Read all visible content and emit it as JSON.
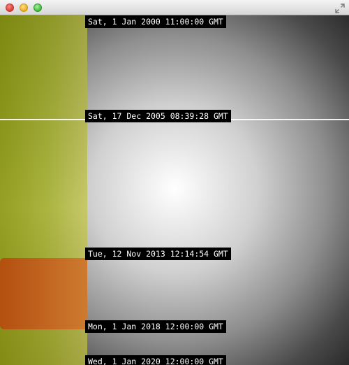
{
  "window": {
    "buttons": [
      "close",
      "minimize",
      "zoom"
    ],
    "fullscreen_icon": "fullscreen-arrows-icon"
  },
  "labels": [
    "Sat, 1 Jan 2000 11:00:00 GMT",
    "Sat, 17 Dec 2005 08:39:28 GMT",
    "Tue, 12 Nov 2013 12:14:54 GMT",
    "Mon, 1 Jan 2018 12:00:00 GMT",
    "Wed, 1 Jan 2020 12:00:00 GMT"
  ],
  "colors": {
    "left_panel": "#a7b13a",
    "orange_block": "#c46a24",
    "label_bg": "#000000",
    "label_text": "#ffffff"
  }
}
